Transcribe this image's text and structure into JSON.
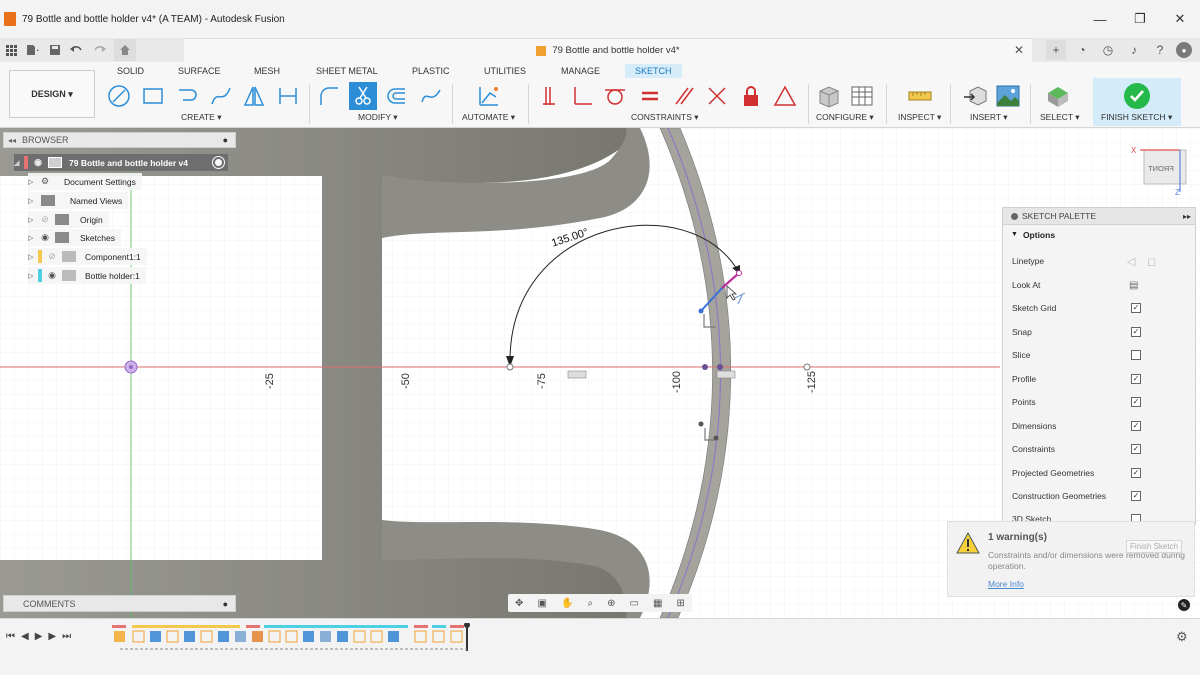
{
  "window": {
    "title": "79 Bottle and bottle holder v4* (A TEAM) - Autodesk Fusion",
    "minimize": "—",
    "maximize": "❐",
    "close": "✕"
  },
  "document_tab": {
    "title": "79 Bottle and bottle holder v4*",
    "close": "✕"
  },
  "ribbon": {
    "workspace": "DESIGN ▾",
    "tabs": [
      "SOLID",
      "SURFACE",
      "MESH",
      "SHEET METAL",
      "PLASTIC",
      "UTILITIES",
      "MANAGE",
      "SKETCH"
    ],
    "active_tab": "SKETCH",
    "groups": {
      "create": "CREATE ▾",
      "modify": "MODIFY ▾",
      "automate": "AUTOMATE ▾",
      "constraints": "CONSTRAINTS ▾",
      "configure": "CONFIGURE ▾",
      "inspect": "INSPECT ▾",
      "insert": "INSERT ▾",
      "select": "SELECT ▾",
      "finish": "FINISH SKETCH ▾"
    }
  },
  "browser": {
    "header": "BROWSER",
    "root": "79 Bottle and bottle holder v4",
    "items": [
      "Document Settings",
      "Named Views",
      "Origin",
      "Sketches",
      "Component1:1",
      "Bottle holder:1"
    ]
  },
  "comments": {
    "header": "COMMENTS"
  },
  "canvas": {
    "dimension": "135.00°",
    "axis_labels": [
      "-25",
      "-50",
      "-75",
      "-100",
      "-125"
    ],
    "viewcube_face": "FRONT",
    "viewcube_x": "X",
    "viewcube_z": "Z"
  },
  "sketch_palette": {
    "header": "SKETCH PALETTE",
    "section": "Options",
    "rows": [
      {
        "label": "Linetype",
        "type": "icons"
      },
      {
        "label": "Look At",
        "type": "icon"
      },
      {
        "label": "Sketch Grid",
        "checked": true
      },
      {
        "label": "Snap",
        "checked": true
      },
      {
        "label": "Slice",
        "checked": false
      },
      {
        "label": "Profile",
        "checked": true
      },
      {
        "label": "Points",
        "checked": true
      },
      {
        "label": "Dimensions",
        "checked": true
      },
      {
        "label": "Constraints",
        "checked": true
      },
      {
        "label": "Projected Geometries",
        "checked": true
      },
      {
        "label": "Construction Geometries",
        "checked": true
      },
      {
        "label": "3D Sketch",
        "checked": false
      }
    ],
    "finish_button": "Finish Sketch"
  },
  "warning": {
    "title": "1 warning(s)",
    "message": "Constraints and/or dimensions were removed during operation.",
    "link": "More Info"
  },
  "colors": {
    "accent": "#2b8ed7",
    "solid_body": "#8b8a84",
    "x_axis": "#e07070",
    "z_axis": "#60c060",
    "finish_green": "#25b84a"
  }
}
